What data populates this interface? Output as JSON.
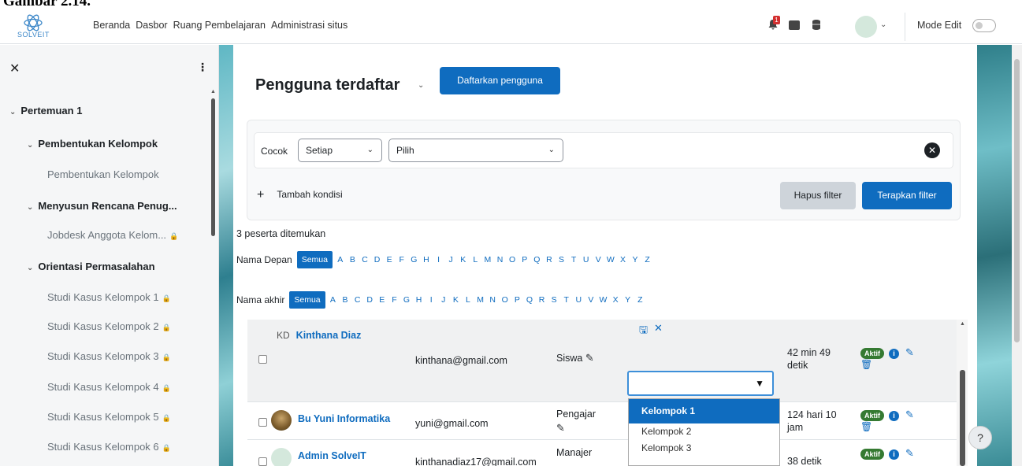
{
  "caption": "Gambar 2.14.",
  "navbar": {
    "logo_text": "SOLVEIT",
    "links": [
      "Beranda",
      "Dasbor",
      "Ruang Pembelajaran",
      "Administrasi situs"
    ],
    "notification_count": "1",
    "mode_edit_label": "Mode Edit",
    "icons": [
      "bell-icon",
      "chat-icon",
      "database-icon",
      "avatar",
      "chevron-down-icon"
    ]
  },
  "drawer": {
    "items": [
      {
        "label": "Pertemuan 1",
        "kind": "section"
      },
      {
        "label": "Pembentukan Kelompok",
        "kind": "section"
      },
      {
        "label": "Pembentukan Kelompok",
        "kind": "activity"
      },
      {
        "label": "Menyusun Rencana Penug...",
        "kind": "section"
      },
      {
        "label": "Jobdesk Anggota Kelom...",
        "kind": "activity",
        "locked": true
      },
      {
        "label": "Orientasi Permasalahan",
        "kind": "section"
      },
      {
        "label": "Studi Kasus Kelompok 1",
        "kind": "activity",
        "locked": true
      },
      {
        "label": "Studi Kasus Kelompok 2",
        "kind": "activity",
        "locked": true
      },
      {
        "label": "Studi Kasus Kelompok 3",
        "kind": "activity",
        "locked": true
      },
      {
        "label": "Studi Kasus Kelompok 4",
        "kind": "activity",
        "locked": true
      },
      {
        "label": "Studi Kasus Kelompok 5",
        "kind": "activity",
        "locked": true
      },
      {
        "label": "Studi Kasus Kelompok 6",
        "kind": "activity",
        "locked": true
      }
    ]
  },
  "main": {
    "title": "Pengguna terdaftar",
    "enrol_button": "Daftarkan pengguna",
    "filter": {
      "match_label": "Cocok",
      "match_value": "Setiap",
      "type_value": "Pilih",
      "add_condition": "Tambah kondisi",
      "clear_button": "Hapus filter",
      "apply_button": "Terapkan filter"
    },
    "found_text": "3 peserta ditemukan",
    "first_name_label": "Nama Depan",
    "last_name_label": "Nama akhir",
    "all_label": "Semua",
    "letters": [
      "A",
      "B",
      "C",
      "D",
      "E",
      "F",
      "G",
      "H",
      "I",
      "J",
      "K",
      "L",
      "M",
      "N",
      "O",
      "P",
      "Q",
      "R",
      "S",
      "T",
      "U",
      "V",
      "W",
      "X",
      "Y",
      "Z"
    ],
    "rows": [
      {
        "initials": "KD",
        "name": "Kinthana Diaz",
        "email": "kinthana@gmail.com",
        "role": "Siswa",
        "last_access": "42 min 49 detik",
        "status": "Aktif",
        "editing_group": true
      },
      {
        "name": "Bu Yuni Informatika",
        "email": "yuni@gmail.com",
        "role": "Pengajar",
        "last_access": "124 hari 10 jam",
        "status": "Aktif"
      },
      {
        "name": "Admin SolveIT",
        "email": "kinthanadiaz17@gmail.com",
        "role": "Manajer",
        "last_access": "38 detik",
        "status": "Aktif"
      }
    ],
    "group_options": [
      "Kelompok 1",
      "Kelompok 2",
      "Kelompok 3"
    ],
    "group_selected": "Kelompok 1"
  },
  "help_label": "?",
  "colors": {
    "primary": "#0f6cbf",
    "active_badge": "#357a32",
    "focus_border": "#3d8fd9"
  }
}
